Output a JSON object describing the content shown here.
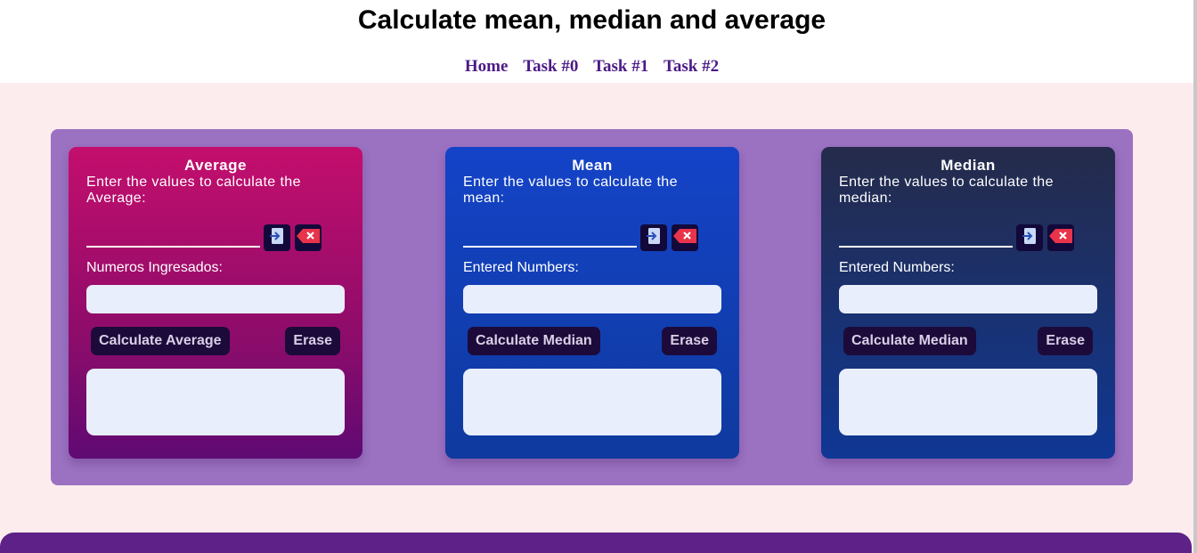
{
  "header": {
    "title": "Calculate mean, median and average",
    "nav": [
      "Home",
      "Task #0",
      "Task #1",
      "Task #2"
    ]
  },
  "cards": [
    {
      "title": "Average",
      "description": "Enter the values to calculate the Average:",
      "entered_label": "Numeros Ingresados:",
      "calc_label": "Calculate Average",
      "erase_label": "Erase"
    },
    {
      "title": "Mean",
      "description": "Enter the values to calculate the mean:",
      "entered_label": "Entered Numbers:",
      "calc_label": "Calculate Median",
      "erase_label": "Erase"
    },
    {
      "title": "Median",
      "description": "Enter the values to calculate the median:",
      "entered_label": "Entered Numbers:",
      "calc_label": "Calculate Median",
      "erase_label": "Erase"
    }
  ],
  "icons": {
    "enter": "enter-arrow-icon",
    "clear": "backspace-x-icon"
  },
  "colors": {
    "nav_link": "#4b1a87",
    "panel": "#9b71c1",
    "background": "#fcecee",
    "footer": "#5e2187"
  }
}
